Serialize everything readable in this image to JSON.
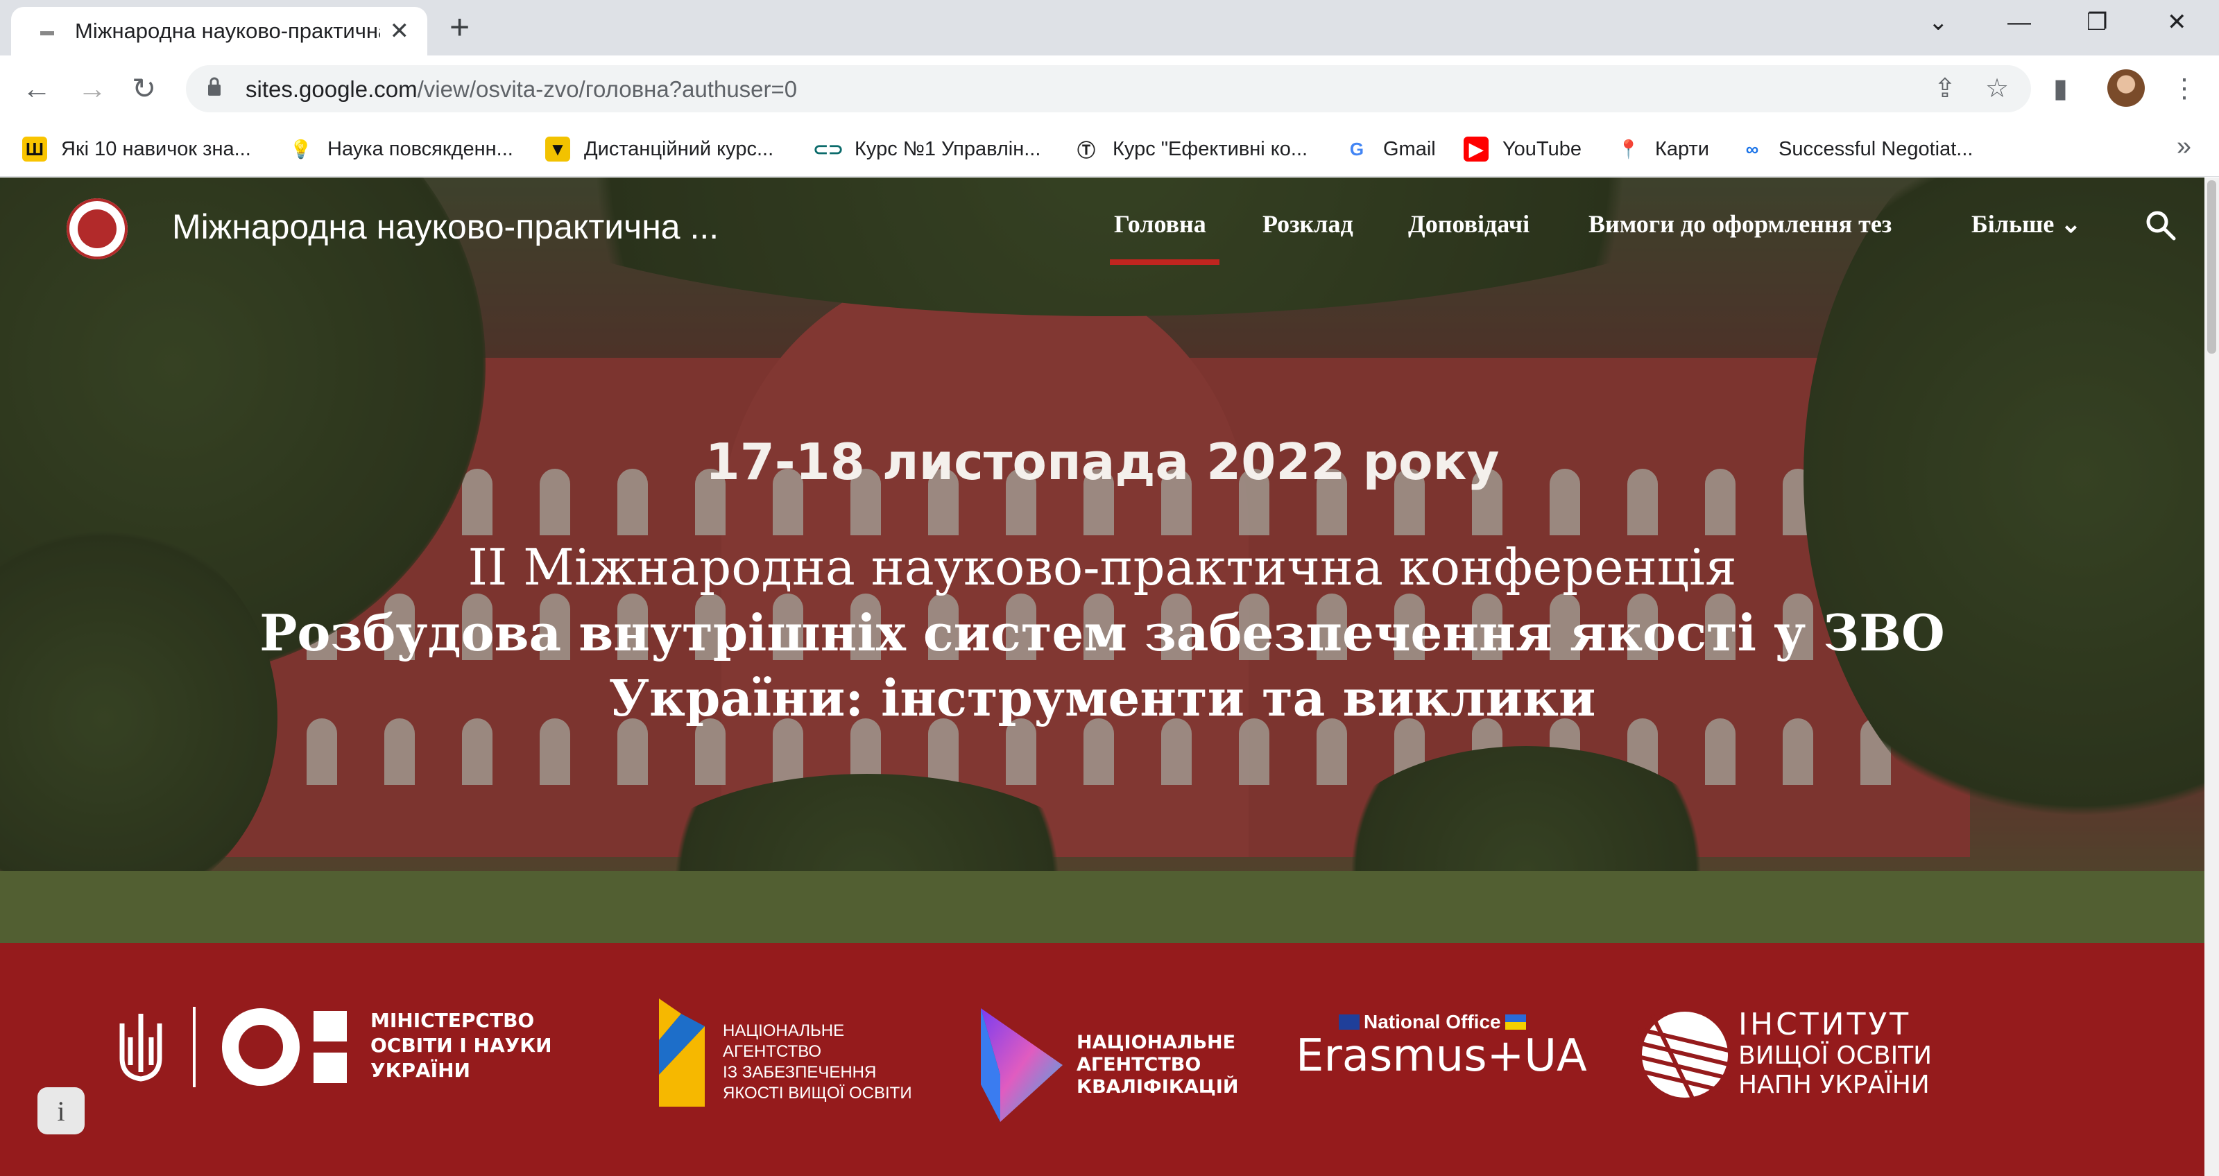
{
  "browser": {
    "tab_title": "Міжнародна науково-практична ...",
    "tab_close": "✕",
    "new_tab": "+",
    "window_controls": {
      "list": "⌄",
      "minimize": "—",
      "restore": "❐",
      "close": "✕"
    },
    "url_host": "sites.google.com",
    "url_path": "/view/osvita-zvo/головна?authuser=0",
    "bookmarks": [
      {
        "label": "Які 10 навичок зна...",
        "icon": "Ш",
        "icon_color": "#f9c400",
        "icon_text_color": "#111"
      },
      {
        "label": "Наука повсякденн...",
        "icon": "💡",
        "icon_color": "#ffffff",
        "icon_text_color": "#333"
      },
      {
        "label": "Дистанційний курс...",
        "icon": "▼",
        "icon_color": "#f2c200",
        "icon_text_color": "#111"
      },
      {
        "label": "Курс №1 Управлін...",
        "icon": "⊂⊃",
        "icon_color": "#ffffff",
        "icon_text_color": "#0b6b6b"
      },
      {
        "label": "Курс \"Ефективні ко...",
        "icon": "Ⓣ",
        "icon_color": "#ffffff",
        "icon_text_color": "#222"
      },
      {
        "label": "Gmail",
        "icon": "G",
        "icon_color": "#ffffff",
        "icon_text_color": "#4285f4"
      },
      {
        "label": "YouTube",
        "icon": "▶",
        "icon_color": "#ff0000",
        "icon_text_color": "#ffffff"
      },
      {
        "label": "Карти",
        "icon": "📍",
        "icon_color": "#ffffff",
        "icon_text_color": "#34a853"
      },
      {
        "label": "Successful Negotiat...",
        "icon": "∞",
        "icon_color": "#ffffff",
        "icon_text_color": "#1a73e8"
      }
    ],
    "bookmarks_more": "»"
  },
  "site": {
    "title": "Міжнародна науково-практична ...",
    "nav": [
      "Головна",
      "Розклад",
      "Доповідачі",
      "Вимоги до оформлення тез",
      "Більше"
    ],
    "nav_more_chevron": "⌄",
    "active_nav": "Головна",
    "accent_color": "#c0251f"
  },
  "hero": {
    "date": "17-18 листопада 2022 року",
    "title_line1": "II Міжнародна науково-практична конференція",
    "title_line2": "Розбудова внутрішніх систем забезпечення якості у ЗВО",
    "title_line3": "України: інструменти та виклики"
  },
  "partners": {
    "background": "#951b1c",
    "mon": [
      "МІНІСТЕРСТВО",
      "ОСВІТИ І НАУКИ",
      "УКРАЇНИ"
    ],
    "naqa": [
      "НАЦІОНАЛЬНЕ",
      "АГЕНТСТВО",
      "ІЗ ЗАБЕЗПЕЧЕННЯ",
      "ЯКОСТІ ВИЩОЇ ОСВІТИ"
    ],
    "nqa": [
      "НАЦІОНАЛЬНЕ",
      "АГЕНТСТВО",
      "КВАЛІФІКАЦІЙ"
    ],
    "erasmus_top": "National Office",
    "erasmus_main": "Erasmus+UA",
    "ihe": [
      "ІНСТИТУТ",
      "ВИЩОЇ ОСВІТИ",
      "НАПН УКРАЇНИ"
    ]
  },
  "info_button": "i"
}
